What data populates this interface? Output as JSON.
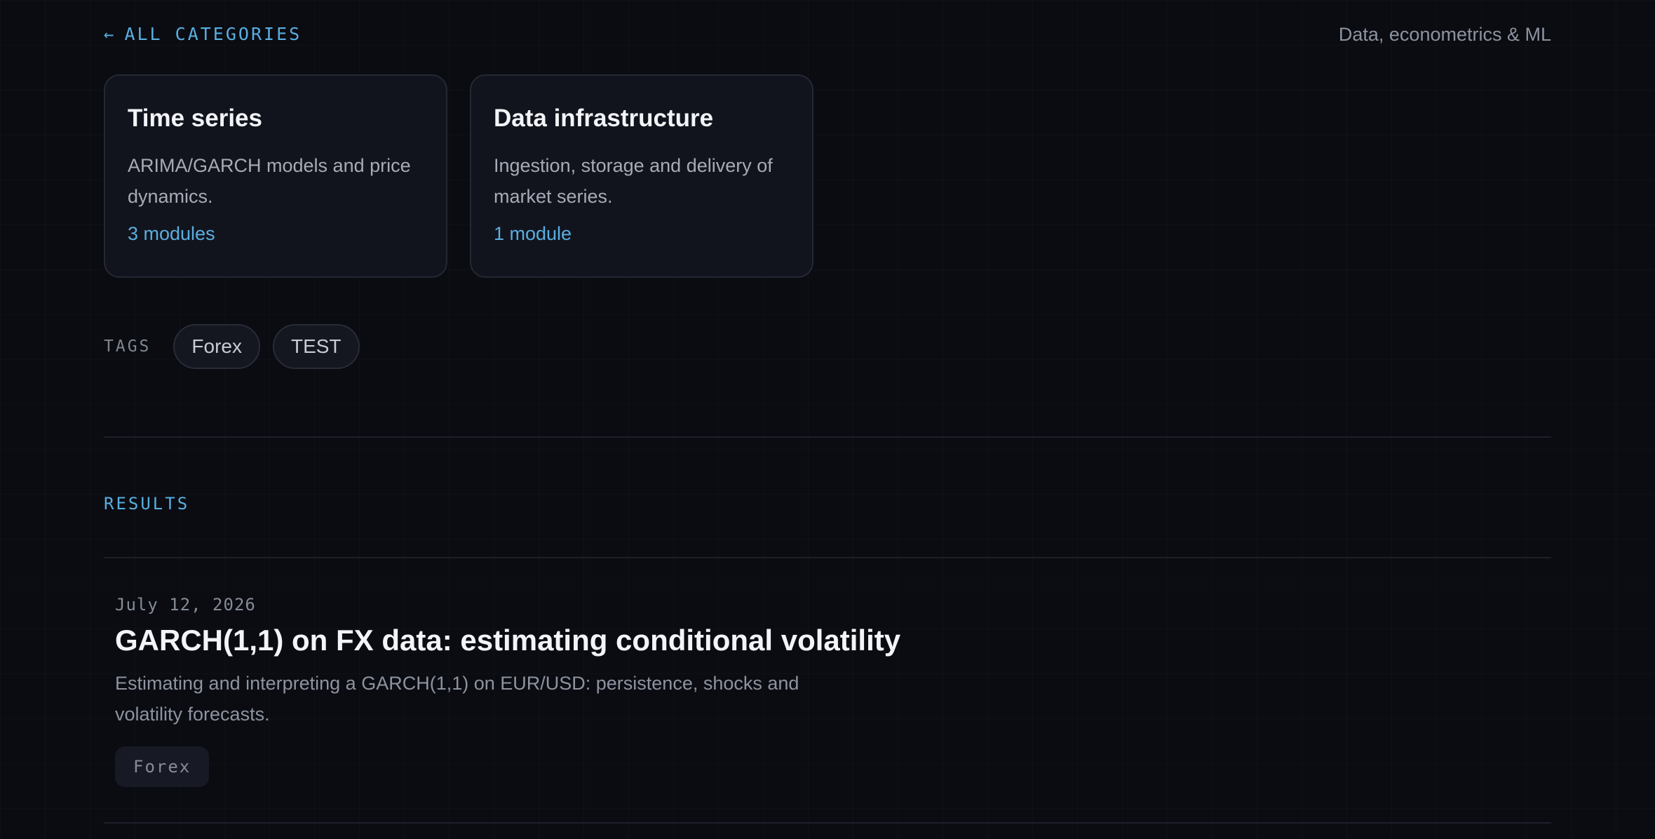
{
  "nav": {
    "back_arrow": "←",
    "back_label": "ALL CATEGORIES",
    "section_subtitle": "Data, econometrics & ML"
  },
  "categories": [
    {
      "title": "Time series",
      "description": "ARIMA/GARCH models and price dynamics.",
      "count": "3 modules"
    },
    {
      "title": "Data infrastructure",
      "description": "Ingestion, storage and delivery of market series.",
      "count": "1 module"
    }
  ],
  "tags": {
    "label": "TAGS",
    "items": [
      "Forex",
      "TEST"
    ]
  },
  "results": {
    "label": "RESULTS",
    "items": [
      {
        "date": "July 12, 2026",
        "title": "GARCH(1,1) on FX data: estimating conditional volatility",
        "description": "Estimating and interpreting a GARCH(1,1) on EUR/USD: persistence, shocks and volatility forecasts.",
        "tag": "Forex"
      }
    ]
  },
  "colors": {
    "background": "#0a0c12",
    "accent": "#5aaee0",
    "card_bg": "#12141d",
    "card_border": "#242833"
  }
}
